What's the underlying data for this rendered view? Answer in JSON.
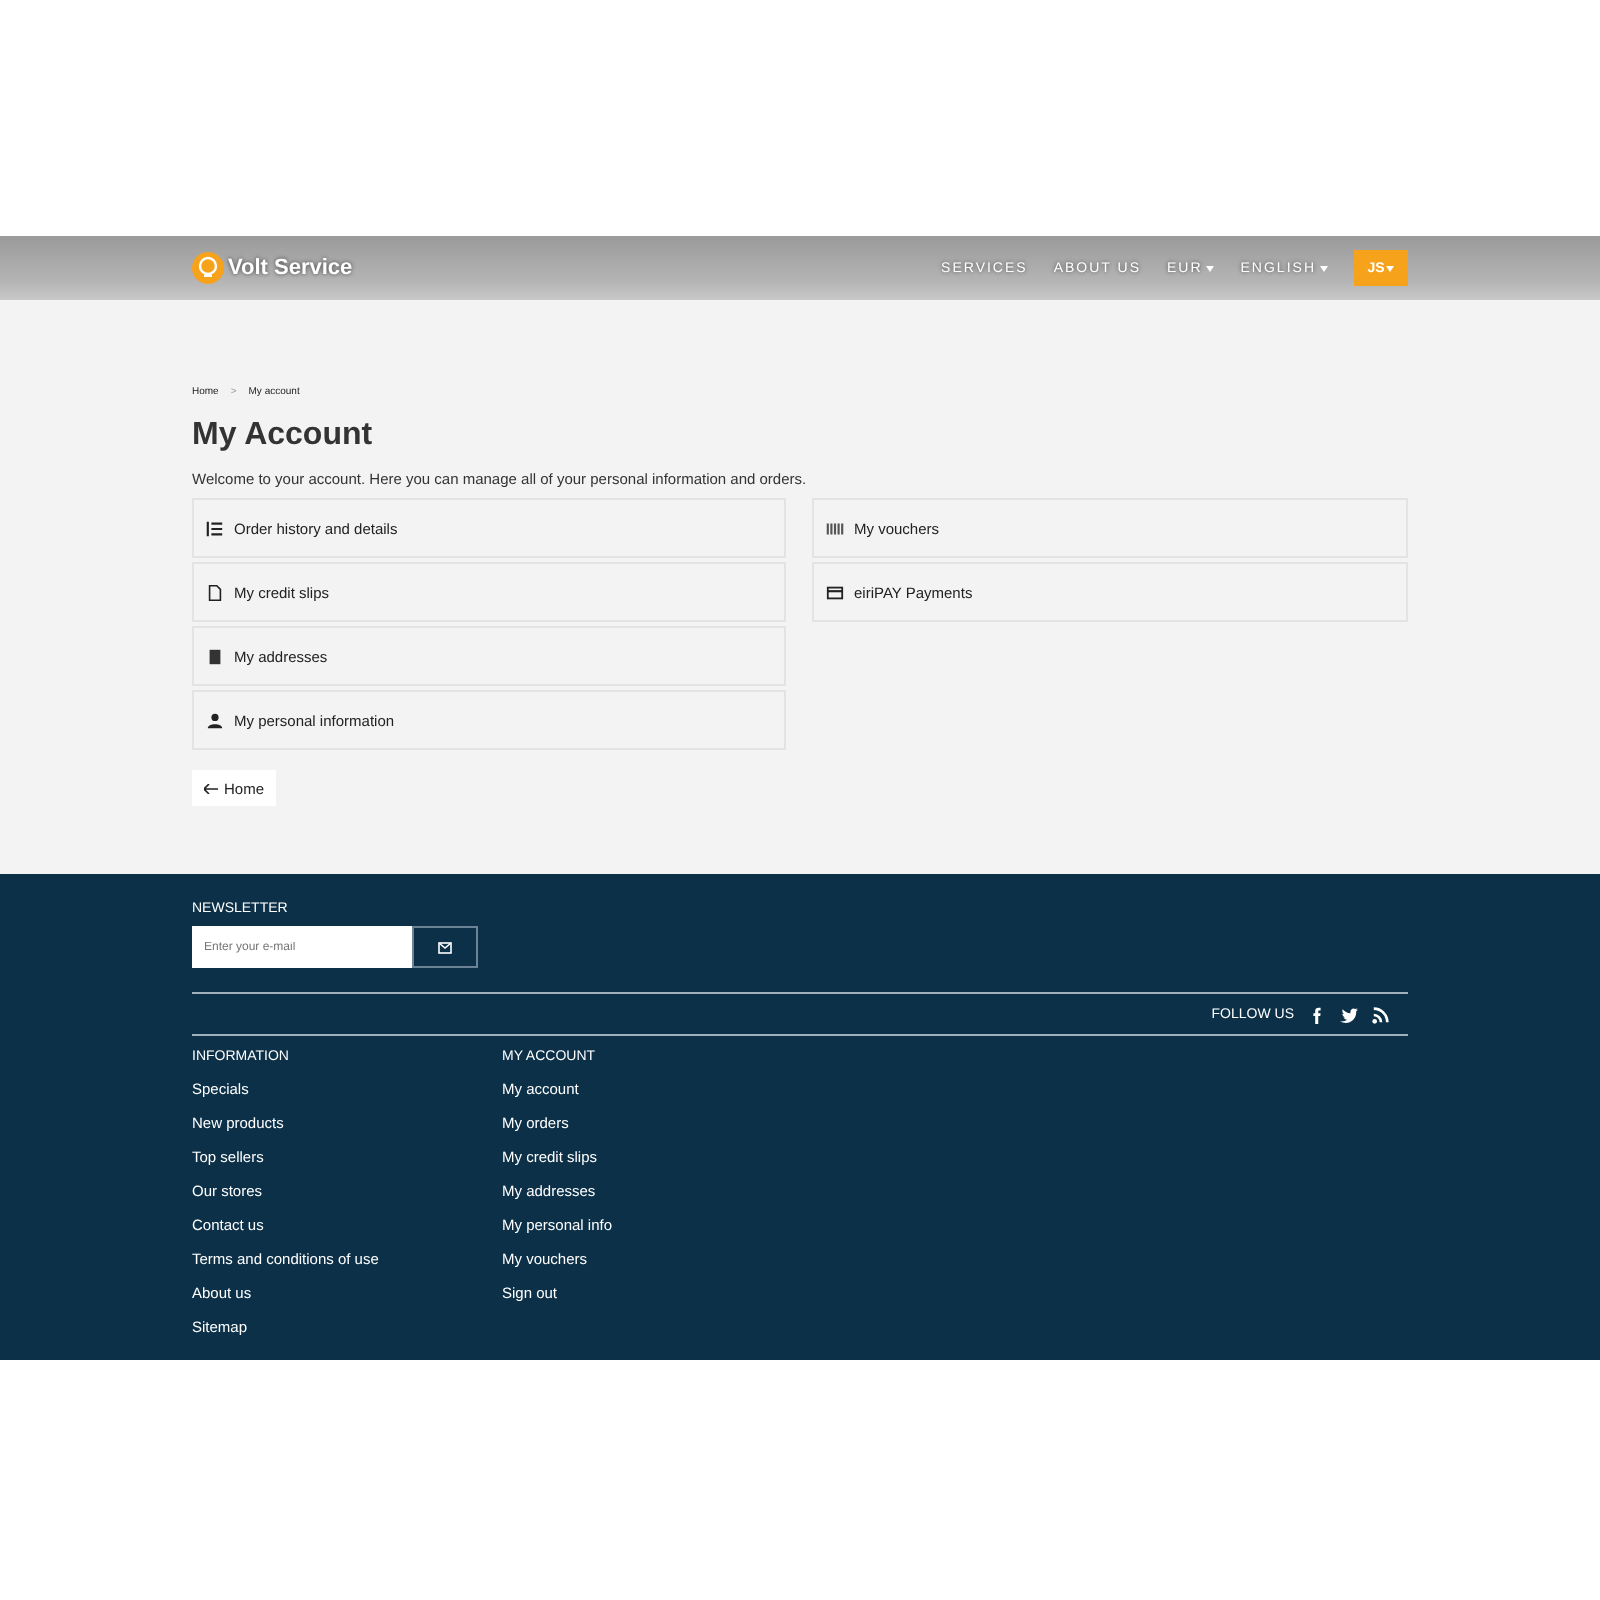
{
  "header": {
    "logo": "Volt Service",
    "nav": [
      {
        "label": "SERVICES",
        "dropdown": false
      },
      {
        "label": "ABOUT US",
        "dropdown": false
      },
      {
        "label": "EUR",
        "dropdown": true
      },
      {
        "label": "ENGLISH",
        "dropdown": true
      }
    ],
    "user_button": "JS"
  },
  "breadcrumb": [
    "Home",
    "My account"
  ],
  "breadcrumb_separator": ">",
  "title": "My Account",
  "intro": "Welcome to your account. Here you can manage all of your personal information and orders.",
  "link_columns": [
    [
      {
        "label": "Order history and details",
        "kind": "list"
      },
      {
        "label": "My credit slips",
        "kind": "file"
      },
      {
        "label": "My addresses",
        "kind": "building"
      },
      {
        "label": "My personal information",
        "kind": "user"
      }
    ],
    [
      {
        "label": "My vouchers",
        "kind": "barcode"
      },
      {
        "label": "eiriPAY Payments",
        "kind": "card"
      }
    ]
  ],
  "back_button": "Home",
  "footer": {
    "newsletter": {
      "heading": "NEWSLETTER",
      "placeholder": "Enter your e-mail"
    },
    "follow_label": "FOLLOW US",
    "social": [
      {
        "kind": "facebook"
      },
      {
        "kind": "twitter"
      },
      {
        "kind": "rss"
      }
    ],
    "columns": [
      {
        "heading": "INFORMATION",
        "links": [
          "Specials",
          "New products",
          "Top sellers",
          "Our stores",
          "Contact us",
          "Terms and conditions of use",
          "About us",
          "Sitemap"
        ]
      },
      {
        "heading": "MY ACCOUNT",
        "links": [
          "My account",
          "My orders",
          "My credit slips",
          "My addresses",
          "My personal info",
          "My vouchers",
          "Sign out"
        ]
      }
    ]
  }
}
